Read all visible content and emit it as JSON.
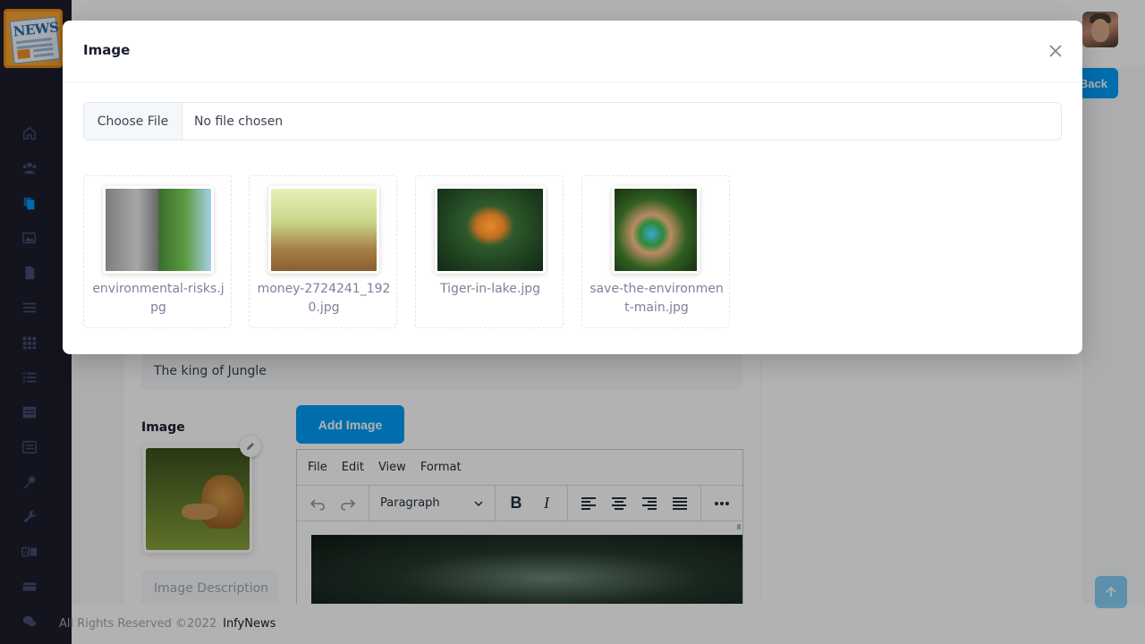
{
  "app": {
    "logo_text": "NEWS",
    "brand": "InfyNews"
  },
  "header": {
    "back_label": "Back"
  },
  "form": {
    "title_value": "The king of Jungle",
    "image_label": "Image",
    "add_image_label": "Add Image",
    "image_description_placeholder": "Image Description"
  },
  "editor": {
    "menu": [
      "File",
      "Edit",
      "View",
      "Format"
    ],
    "block_format": "Paragraph"
  },
  "footer": {
    "copyright": "All Rights Reserved ©2022",
    "brand": "InfyNews"
  },
  "modal": {
    "title": "Image",
    "choose_file_label": "Choose File",
    "no_file_text": "No file chosen",
    "images": [
      {
        "name": "environmental-risks.jpg"
      },
      {
        "name": "money-2724241_1920.jpg"
      },
      {
        "name": "Tiger-in-lake.jpg"
      },
      {
        "name": "save-the-environment-main.jpg"
      }
    ]
  },
  "sidebar": {
    "icons": [
      "home-icon",
      "users-icon",
      "documents-icon",
      "images-icon",
      "file-icon",
      "menu-icon",
      "grid-icon",
      "list-icon",
      "table-icon",
      "news-icon",
      "key-icon",
      "wrench-icon",
      "translate-icon",
      "card-icon",
      "chat-icon"
    ]
  },
  "colors": {
    "primary": "#009ef7",
    "sidebar": "#1e1e2d",
    "logo_orange": "#f7a531"
  }
}
